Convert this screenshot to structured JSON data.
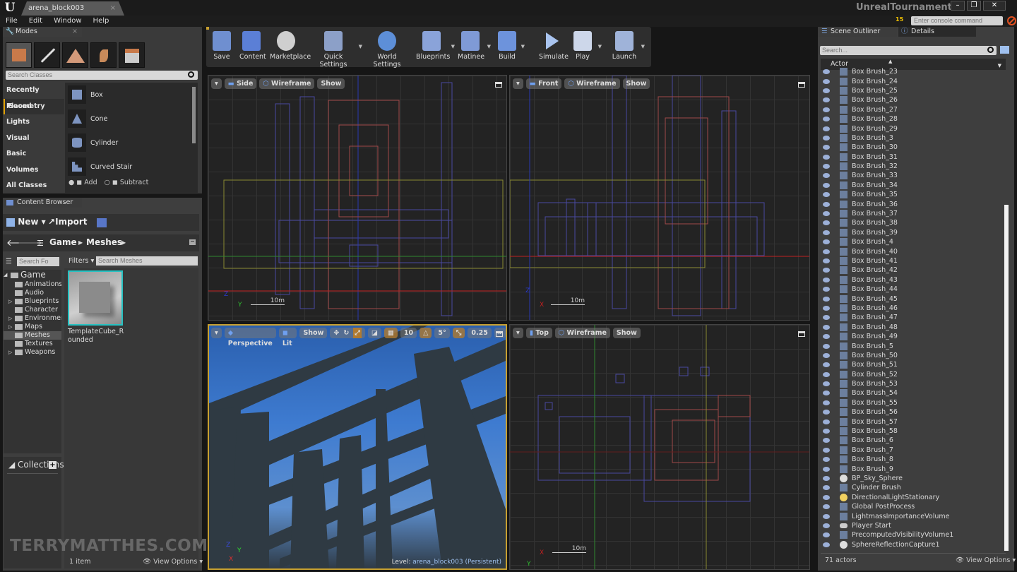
{
  "window": {
    "document_tab": "arena_block003",
    "app_title": "UnrealTournament",
    "console_placeholder": "Enter console command",
    "notification_count": "15",
    "minimize": "–",
    "maximize": "❐",
    "close": "✕"
  },
  "menu": [
    "File",
    "Edit",
    "Window",
    "Help"
  ],
  "modes": {
    "tab_label": "Modes",
    "mode_icons": [
      "place-mode",
      "paint-mode",
      "landscape-mode",
      "foliage-mode",
      "geometry-edit-mode"
    ],
    "search_placeholder": "Search Classes",
    "categories": [
      "Recently Placed",
      "Geometry",
      "Lights",
      "Visual",
      "Basic",
      "Volumes",
      "All Classes"
    ],
    "selected_category": "Geometry",
    "classes": [
      "Box",
      "Cone",
      "Cylinder",
      "Curved Stair"
    ],
    "add_label": "Add",
    "subtract_label": "Subtract"
  },
  "toolbar": {
    "buttons": [
      {
        "label": "Save",
        "icon": "save-icon",
        "color": "#6f8fd0"
      },
      {
        "label": "Content",
        "icon": "content-icon",
        "color": "#5b7fd6"
      },
      {
        "label": "Marketplace",
        "icon": "marketplace-icon",
        "color": "#cfcfcf"
      },
      {
        "label": "Quick Settings",
        "icon": "settings-icon",
        "color": "#8ca0c8"
      },
      {
        "label": "World Settings",
        "icon": "globe-icon",
        "color": "#5d8fd8"
      },
      {
        "label": "Blueprints",
        "icon": "blueprint-icon",
        "color": "#8aa3d9"
      },
      {
        "label": "Matinee",
        "icon": "clapper-icon",
        "color": "#7f9ad6"
      },
      {
        "label": "Build",
        "icon": "build-icon",
        "color": "#6d93dc"
      },
      {
        "label": "Simulate",
        "icon": "play-icon",
        "color": "#a9c4ef"
      },
      {
        "label": "Play",
        "icon": "gamepad-icon",
        "color": "#cdd7ea"
      },
      {
        "label": "Launch",
        "icon": "launch-icon",
        "color": "#9fb3d9"
      }
    ]
  },
  "viewports": {
    "side": {
      "view": "Side",
      "mode": "Wireframe",
      "show": "Show",
      "scale": "10m",
      "axis_a": "Z",
      "axis_b": "Y"
    },
    "front": {
      "view": "Front",
      "mode": "Wireframe",
      "show": "Show",
      "scale": "10m",
      "axis_a": "Z",
      "axis_b": "X"
    },
    "perspective": {
      "view": "Perspective",
      "mode": "Lit",
      "show": "Show",
      "grid_snap": "10",
      "rotation_snap": "5°",
      "scale_snap": "0.25",
      "level_label": "Level:",
      "level_name": "arena_block003 (Persistent)",
      "axis_z": "Z",
      "axis_y": "Y",
      "axis_x": "X"
    },
    "top": {
      "view": "Top",
      "mode": "Wireframe",
      "show": "Show",
      "scale": "10m",
      "axis_a": "X",
      "axis_b": "Y"
    }
  },
  "content_browser": {
    "tab_label": "Content Browser",
    "new_label": "New",
    "import_label": "Import",
    "path": [
      "Game",
      "Meshes"
    ],
    "folder_search_placeholder": "Search Fo",
    "filters_label": "Filters",
    "asset_search_placeholder": "Search Meshes",
    "folders": [
      {
        "name": "Game",
        "level": 0,
        "expandable": true
      },
      {
        "name": "Animations",
        "level": 1,
        "expandable": false
      },
      {
        "name": "Audio",
        "level": 1,
        "expandable": false
      },
      {
        "name": "Blueprints",
        "level": 1,
        "expandable": true
      },
      {
        "name": "Character",
        "level": 1,
        "expandable": false
      },
      {
        "name": "Environment",
        "level": 1,
        "expandable": true
      },
      {
        "name": "Maps",
        "level": 1,
        "expandable": true
      },
      {
        "name": "Meshes",
        "level": 1,
        "expandable": false,
        "selected": true
      },
      {
        "name": "Textures",
        "level": 1,
        "expandable": false
      },
      {
        "name": "Weapons",
        "level": 1,
        "expandable": true
      }
    ],
    "assets": [
      {
        "name": "TemplateCube_Rounded"
      }
    ],
    "collections_label": "Collections",
    "item_count": "1 item",
    "view_options": "View Options"
  },
  "outliner": {
    "tab_label": "Scene Outliner",
    "details_tab_label": "Details",
    "search_placeholder": "Search...",
    "column_header": "Actor",
    "actors": [
      {
        "name": "Box Brush_23",
        "type": "brush"
      },
      {
        "name": "Box Brush_24",
        "type": "brush"
      },
      {
        "name": "Box Brush_25",
        "type": "brush"
      },
      {
        "name": "Box Brush_26",
        "type": "brush"
      },
      {
        "name": "Box Brush_27",
        "type": "brush"
      },
      {
        "name": "Box Brush_28",
        "type": "brush"
      },
      {
        "name": "Box Brush_29",
        "type": "brush"
      },
      {
        "name": "Box Brush_3",
        "type": "brush"
      },
      {
        "name": "Box Brush_30",
        "type": "brush"
      },
      {
        "name": "Box Brush_31",
        "type": "brush"
      },
      {
        "name": "Box Brush_32",
        "type": "brush"
      },
      {
        "name": "Box Brush_33",
        "type": "brush"
      },
      {
        "name": "Box Brush_34",
        "type": "brush"
      },
      {
        "name": "Box Brush_35",
        "type": "brush"
      },
      {
        "name": "Box Brush_36",
        "type": "brush"
      },
      {
        "name": "Box Brush_37",
        "type": "brush"
      },
      {
        "name": "Box Brush_38",
        "type": "brush"
      },
      {
        "name": "Box Brush_39",
        "type": "brush"
      },
      {
        "name": "Box Brush_4",
        "type": "brush"
      },
      {
        "name": "Box Brush_40",
        "type": "brush"
      },
      {
        "name": "Box Brush_41",
        "type": "brush"
      },
      {
        "name": "Box Brush_42",
        "type": "brush"
      },
      {
        "name": "Box Brush_43",
        "type": "brush"
      },
      {
        "name": "Box Brush_44",
        "type": "brush"
      },
      {
        "name": "Box Brush_45",
        "type": "brush"
      },
      {
        "name": "Box Brush_46",
        "type": "brush"
      },
      {
        "name": "Box Brush_47",
        "type": "brush"
      },
      {
        "name": "Box Brush_48",
        "type": "brush"
      },
      {
        "name": "Box Brush_49",
        "type": "brush"
      },
      {
        "name": "Box Brush_5",
        "type": "brush"
      },
      {
        "name": "Box Brush_50",
        "type": "brush"
      },
      {
        "name": "Box Brush_51",
        "type": "brush"
      },
      {
        "name": "Box Brush_52",
        "type": "brush"
      },
      {
        "name": "Box Brush_53",
        "type": "brush"
      },
      {
        "name": "Box Brush_54",
        "type": "brush"
      },
      {
        "name": "Box Brush_55",
        "type": "brush"
      },
      {
        "name": "Box Brush_56",
        "type": "brush"
      },
      {
        "name": "Box Brush_57",
        "type": "brush"
      },
      {
        "name": "Box Brush_58",
        "type": "brush"
      },
      {
        "name": "Box Brush_6",
        "type": "brush"
      },
      {
        "name": "Box Brush_7",
        "type": "brush"
      },
      {
        "name": "Box Brush_8",
        "type": "brush"
      },
      {
        "name": "Box Brush_9",
        "type": "brush"
      },
      {
        "name": "BP_Sky_Sphere",
        "type": "sphere"
      },
      {
        "name": "Cylinder Brush",
        "type": "brush"
      },
      {
        "name": "DirectionalLightStationary",
        "type": "light"
      },
      {
        "name": "Global PostProcess",
        "type": "volume"
      },
      {
        "name": "LightmassImportanceVolume",
        "type": "volume"
      },
      {
        "name": "Player Start",
        "type": "player"
      },
      {
        "name": "PrecomputedVisibilityVolume1",
        "type": "volume"
      },
      {
        "name": "SphereReflectionCapture1",
        "type": "sphere"
      }
    ],
    "actor_count": "71 actors",
    "view_options": "View Options"
  },
  "watermark": "TERRYMATTHES.COM"
}
